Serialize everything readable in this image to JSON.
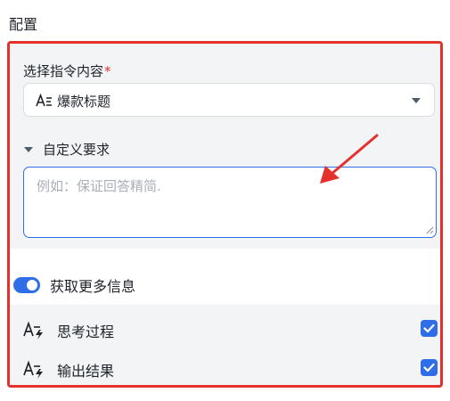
{
  "section": {
    "title": "配置"
  },
  "instruction": {
    "label": "选择指令内容",
    "required_mark": "*",
    "selected_value": "爆款标题",
    "selected_icon": "text-format-icon"
  },
  "custom_requirements": {
    "label": "自定义要求",
    "expanded": true,
    "placeholder": "例如：保证回答精简.",
    "value": ""
  },
  "more_info": {
    "label": "获取更多信息",
    "enabled": true,
    "options": [
      {
        "label": "思考过程",
        "icon": "text-lightning-icon",
        "checked": true
      },
      {
        "label": "输出结果",
        "icon": "text-lightning-icon",
        "checked": true
      }
    ]
  },
  "colors": {
    "accent": "#2f6ee8",
    "highlight_border": "#e5312b",
    "panel_bg": "#f3f4f6"
  }
}
